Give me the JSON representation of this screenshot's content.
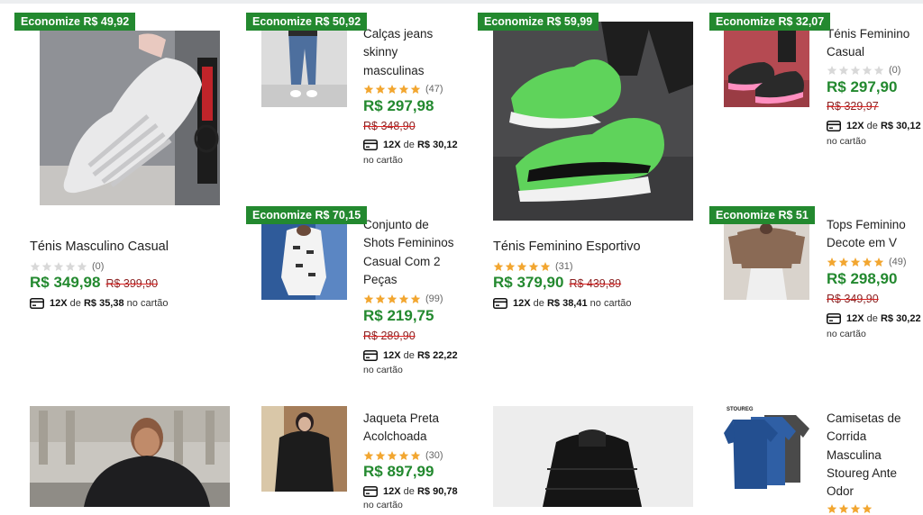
{
  "products": [
    {
      "badge": "Economize R$ 49,92",
      "title": "Ténis Masculino Casual",
      "rating_count": "(0)",
      "price": "R$ 349,98",
      "old_price": "R$ 399,90",
      "inst_qty": "12X",
      "inst_de": "de",
      "inst_value": "R$ 35,38",
      "inst_cart": "no cartão",
      "stars_filled": 0
    },
    {
      "badge": "Economize R$ 50,92",
      "title_lines": [
        "Calças jeans",
        "skinny",
        "masculinas"
      ],
      "rating_count": "(47)",
      "price": "R$ 297,98",
      "old_price": "R$ 348,90",
      "inst_qty": "12X",
      "inst_de": "de",
      "inst_value": "R$ 30,12",
      "inst_cart": "no cartão",
      "stars_filled": 5
    },
    {
      "badge": "Economize R$ 59,99",
      "title": "Ténis Feminino Esportivo",
      "rating_count": "(31)",
      "price": "R$ 379,90",
      "old_price": "R$ 439,89",
      "inst_qty": "12X",
      "inst_de": "de",
      "inst_value": "R$ 38,41",
      "inst_cart": "no cartão",
      "stars_filled": 5
    },
    {
      "badge": "Economize R$ 32,07",
      "title_lines": [
        "Ténis Feminino",
        "Casual"
      ],
      "rating_count": "(0)",
      "price": "R$ 297,90",
      "old_price": "R$ 329,97",
      "inst_qty": "12X",
      "inst_de": "de",
      "inst_value": "R$ 30,12",
      "inst_cart": "no cartão",
      "stars_filled": 0
    },
    {
      "badge": "Economize R$ 70,15",
      "title_lines": [
        "Conjunto de",
        "Shots Femininos",
        "Casual Com 2",
        "Peças"
      ],
      "rating_count": "(99)",
      "price": "R$ 219,75",
      "old_price": "R$ 289,90",
      "inst_qty": "12X",
      "inst_de": "de",
      "inst_value": "R$ 22,22",
      "inst_cart": "no cartão",
      "stars_filled": 5
    },
    {
      "badge": "Economize R$ 51",
      "title_lines": [
        "Tops Feminino",
        "Decote em V"
      ],
      "rating_count": "(49)",
      "price": "R$ 298,90",
      "old_price": "R$ 349,90",
      "inst_qty": "12X",
      "inst_de": "de",
      "inst_value": "R$ 30,22",
      "inst_cart": "no cartão",
      "stars_filled": 5
    },
    {
      "title_lines": [
        "Jaqueta Preta",
        "Acolchoada"
      ],
      "rating_count": "(30)",
      "price": "R$ 897,99",
      "inst_qty": "12X",
      "inst_de": "de",
      "inst_value": "R$ 90,78",
      "inst_cart": "no cartão",
      "stars_filled": 5
    },
    {
      "title_lines": [
        "Camisetas de",
        "Corrida",
        "Masculina",
        "Stoureg Ante",
        "Odor"
      ],
      "stars_filled": 5
    },
    {
      "brand_label": "STOUREG"
    }
  ],
  "colors": {
    "accent_green": "#23892f",
    "star": "#f2a630",
    "star_empty": "#d8d8d8",
    "old_price": "#8a1f1f"
  }
}
